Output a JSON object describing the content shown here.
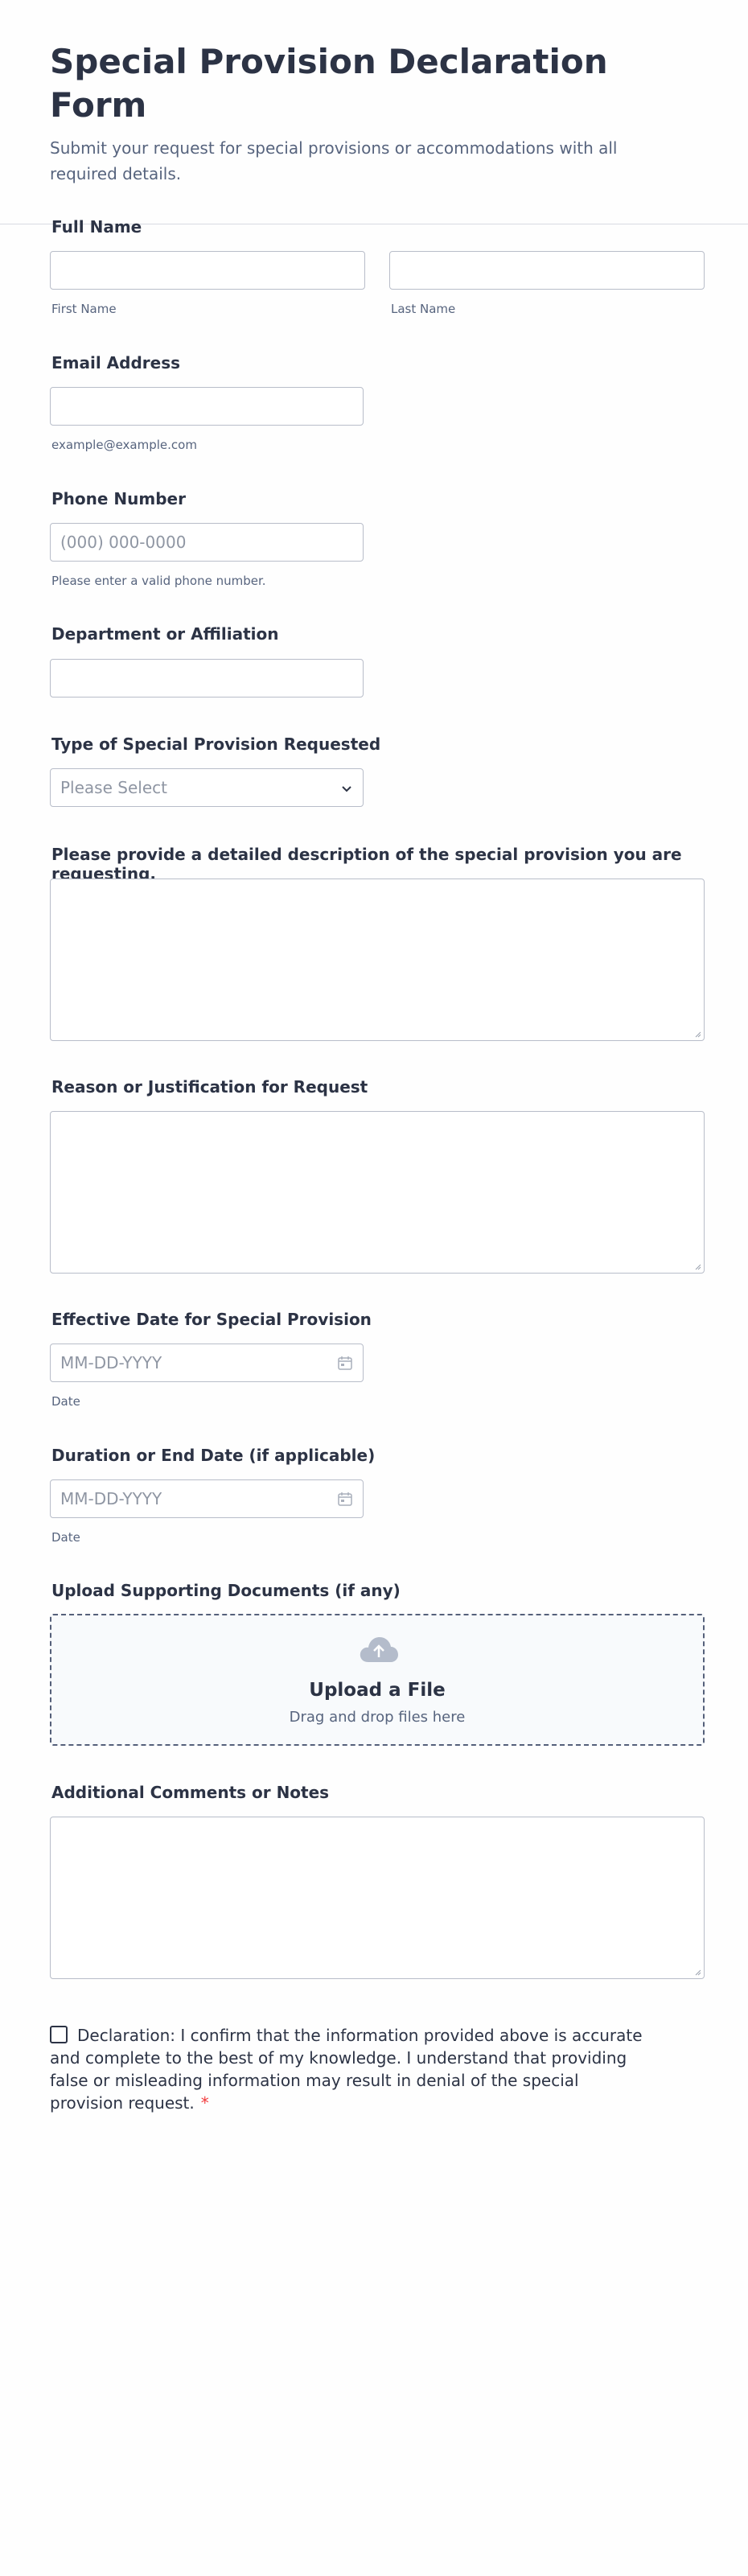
{
  "header": {
    "title": "Special Provision Declaration Form",
    "subtitle": "Submit your request for special provisions or accommodations with all required details."
  },
  "fields": {
    "full_name": {
      "label": "Full Name",
      "first_sub": "First Name",
      "last_sub": "Last Name"
    },
    "email": {
      "label": "Email Address",
      "sub": "example@example.com"
    },
    "phone": {
      "label": "Phone Number",
      "placeholder": "(000) 000-0000",
      "sub": "Please enter a valid phone number."
    },
    "department": {
      "label": "Department or Affiliation"
    },
    "provision_type": {
      "label": "Type of Special Provision Requested",
      "placeholder": "Please Select"
    },
    "description": {
      "label": "Please provide a detailed description of the special provision you are requesting."
    },
    "reason": {
      "label": "Reason or Justification for Request"
    },
    "effective_date": {
      "label": "Effective Date for Special Provision",
      "placeholder": "MM-DD-YYYY",
      "sub": "Date"
    },
    "end_date": {
      "label": "Duration or End Date (if applicable)",
      "placeholder": "MM-DD-YYYY",
      "sub": "Date"
    },
    "upload": {
      "label": "Upload Supporting Documents (if any)",
      "title": "Upload a File",
      "sub": "Drag and drop files here"
    },
    "comments": {
      "label": "Additional Comments or Notes"
    },
    "declaration": {
      "text": "Declaration: I confirm that the information provided above is accurate and complete to the best of my knowledge. I understand that providing false or misleading information may result in denial of the special provision request.",
      "required_mark": "*"
    }
  },
  "colors": {
    "text": "#2c3345",
    "muted": "#57647e",
    "border": "#b8bdc9",
    "required": "#f23a3c"
  }
}
